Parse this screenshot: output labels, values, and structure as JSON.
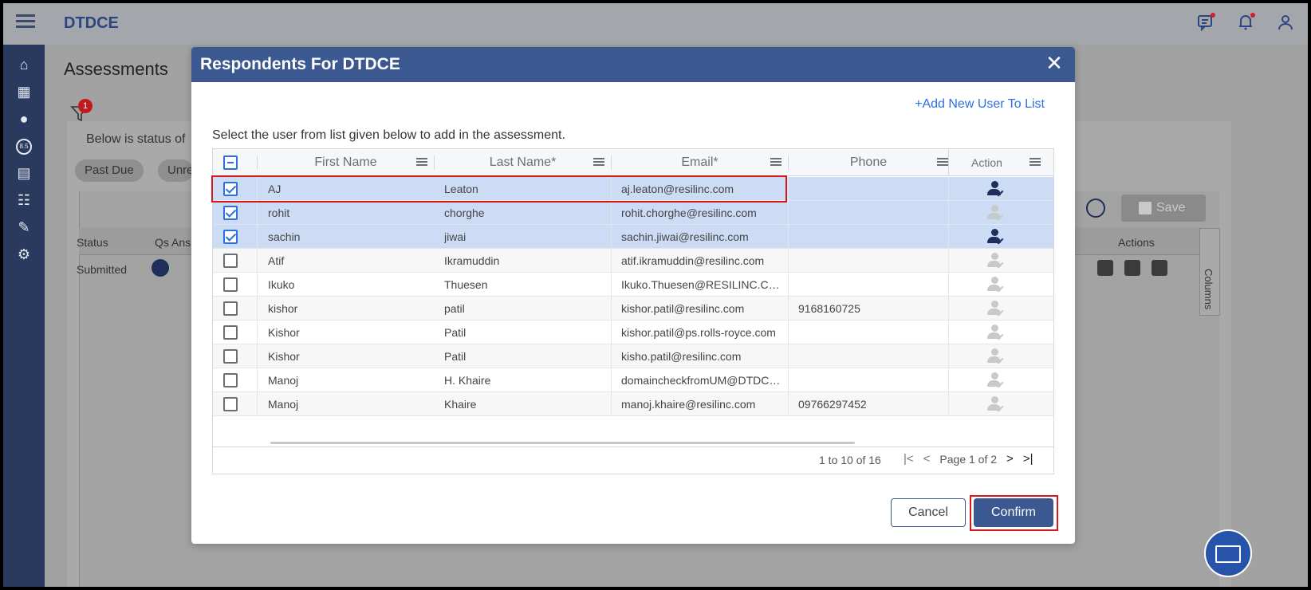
{
  "app": {
    "title": "DTDCE"
  },
  "topbar_icons": [
    "chat-alert-icon",
    "bell-icon",
    "user-icon"
  ],
  "sidebar_icons": [
    "home-icon",
    "calendar-icon",
    "user-settings-icon",
    "score-icon",
    "clipboard-icon",
    "hierarchy-icon",
    "user-edit-icon",
    "gear-icon"
  ],
  "sidebar_score_text": "8.5",
  "background": {
    "page_title": "Assessments",
    "filter_badge": "1",
    "status_text": "Below is status of",
    "pills": [
      "Past Due",
      "Unre"
    ],
    "columns": {
      "status": "Status",
      "qs": "Qs Ans",
      "actions": "Actions"
    },
    "row_status": "Submitted",
    "row_count": "1",
    "save_label": "Save",
    "columns_tab": "Columns"
  },
  "modal": {
    "title": "Respondents For DTDCE",
    "close_label": "✕",
    "add_user_link": "+Add New User To List",
    "instruction": "Select the user from list given below to add in the assessment.",
    "columns": [
      "First Name",
      "Last Name*",
      "Email*",
      "Phone",
      "Action"
    ],
    "rows": [
      {
        "first": "AJ",
        "last": "Leaton",
        "email": "aj.leaton@resilinc.com",
        "phone": "",
        "checked": true,
        "active": true
      },
      {
        "first": "rohit",
        "last": "chorghe",
        "email": "rohit.chorghe@resilinc.com",
        "phone": "",
        "checked": true,
        "active": false
      },
      {
        "first": "sachin",
        "last": "jiwai",
        "email": "sachin.jiwai@resilinc.com",
        "phone": "",
        "checked": true,
        "active": true
      },
      {
        "first": "Atif",
        "last": "Ikramuddin",
        "email": "atif.ikramuddin@resilinc.com",
        "phone": "",
        "checked": false,
        "active": false
      },
      {
        "first": "Ikuko",
        "last": "Thuesen",
        "email": "Ikuko.Thuesen@RESILINC.COM",
        "phone": "",
        "checked": false,
        "active": false
      },
      {
        "first": "kishor",
        "last": "patil",
        "email": "kishor.patil@resilinc.com",
        "phone": "9168160725",
        "checked": false,
        "active": false
      },
      {
        "first": "Kishor",
        "last": "Patil",
        "email": "kishor.patil@ps.rolls-royce.com",
        "phone": "",
        "checked": false,
        "active": false
      },
      {
        "first": "Kishor",
        "last": "Patil",
        "email": "kisho.patil@resilinc.com",
        "phone": "",
        "checked": false,
        "active": false
      },
      {
        "first": "Manoj",
        "last": "H. Khaire",
        "email": "domaincheckfromUM@DTDCE...",
        "phone": "",
        "checked": false,
        "active": false
      },
      {
        "first": "Manoj",
        "last": "Khaire",
        "email": "manoj.khaire@resilinc.com",
        "phone": "09766297452",
        "checked": false,
        "active": false
      }
    ],
    "pagination": {
      "range": "1 to 10 of 16",
      "page_text": "Page 1 of 2",
      "first_icon": "|<",
      "prev_icon": "<",
      "next_icon": ">",
      "last_icon": ">|"
    },
    "cancel_label": "Cancel",
    "confirm_label": "Confirm"
  },
  "colors": {
    "header_blue": "#3b5891",
    "selected_row": "#ccdcf5",
    "link_blue": "#2d6fe0",
    "highlight_red": "#d5191b"
  }
}
